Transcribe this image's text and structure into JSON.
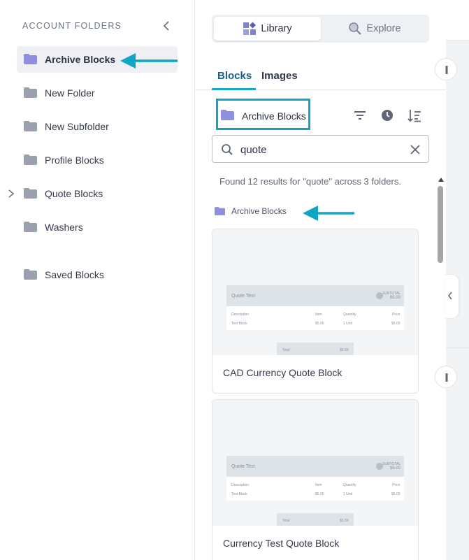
{
  "sidebar": {
    "heading": "ACCOUNT FOLDERS",
    "items": [
      {
        "label": "Archive Blocks",
        "active": true
      },
      {
        "label": "New Folder"
      },
      {
        "label": "New Subfolder"
      },
      {
        "label": "Profile Blocks"
      },
      {
        "label": "Quote Blocks",
        "expandable": true
      },
      {
        "label": "Washers"
      },
      {
        "label": "Saved Blocks"
      }
    ]
  },
  "segmented": {
    "library": "Library",
    "explore": "Explore"
  },
  "tabs": {
    "blocks": "Blocks",
    "images": "Images"
  },
  "current_folder": "Archive Blocks",
  "search": {
    "value": "quote"
  },
  "results": {
    "summary": "Found 12 results for \"quote\" across 3 folders."
  },
  "group": {
    "folder": "Archive Blocks"
  },
  "cards": [
    {
      "title": "CAD Currency Quote Block",
      "preview": {
        "heading": "Quote Test",
        "subtotal_label": "SUBTOTAL",
        "subtotal": "$5.00",
        "cols": [
          "Description",
          "Item",
          "Quantity",
          "Price"
        ],
        "row": [
          "Test Block",
          "$5.00",
          "1 Unit",
          "$5.00"
        ],
        "total_label": "Total",
        "total": "$5.00"
      }
    },
    {
      "title": "Currency Test Quote Block",
      "preview": {
        "heading": "Quote Test",
        "subtotal_label": "SUBTOTAL",
        "subtotal": "$5.00",
        "cols": [
          "Description",
          "Item",
          "Quantity",
          "Price"
        ],
        "row": [
          "Test Block",
          "$5.00",
          "1 Unit",
          "$5.00"
        ],
        "total_label": "Total",
        "total": "$5.00"
      }
    }
  ],
  "colors": {
    "accent": "#10a5c4",
    "folder": "#9aa0b0",
    "folder_active": "#8f8fe0",
    "text": "#33394d"
  }
}
